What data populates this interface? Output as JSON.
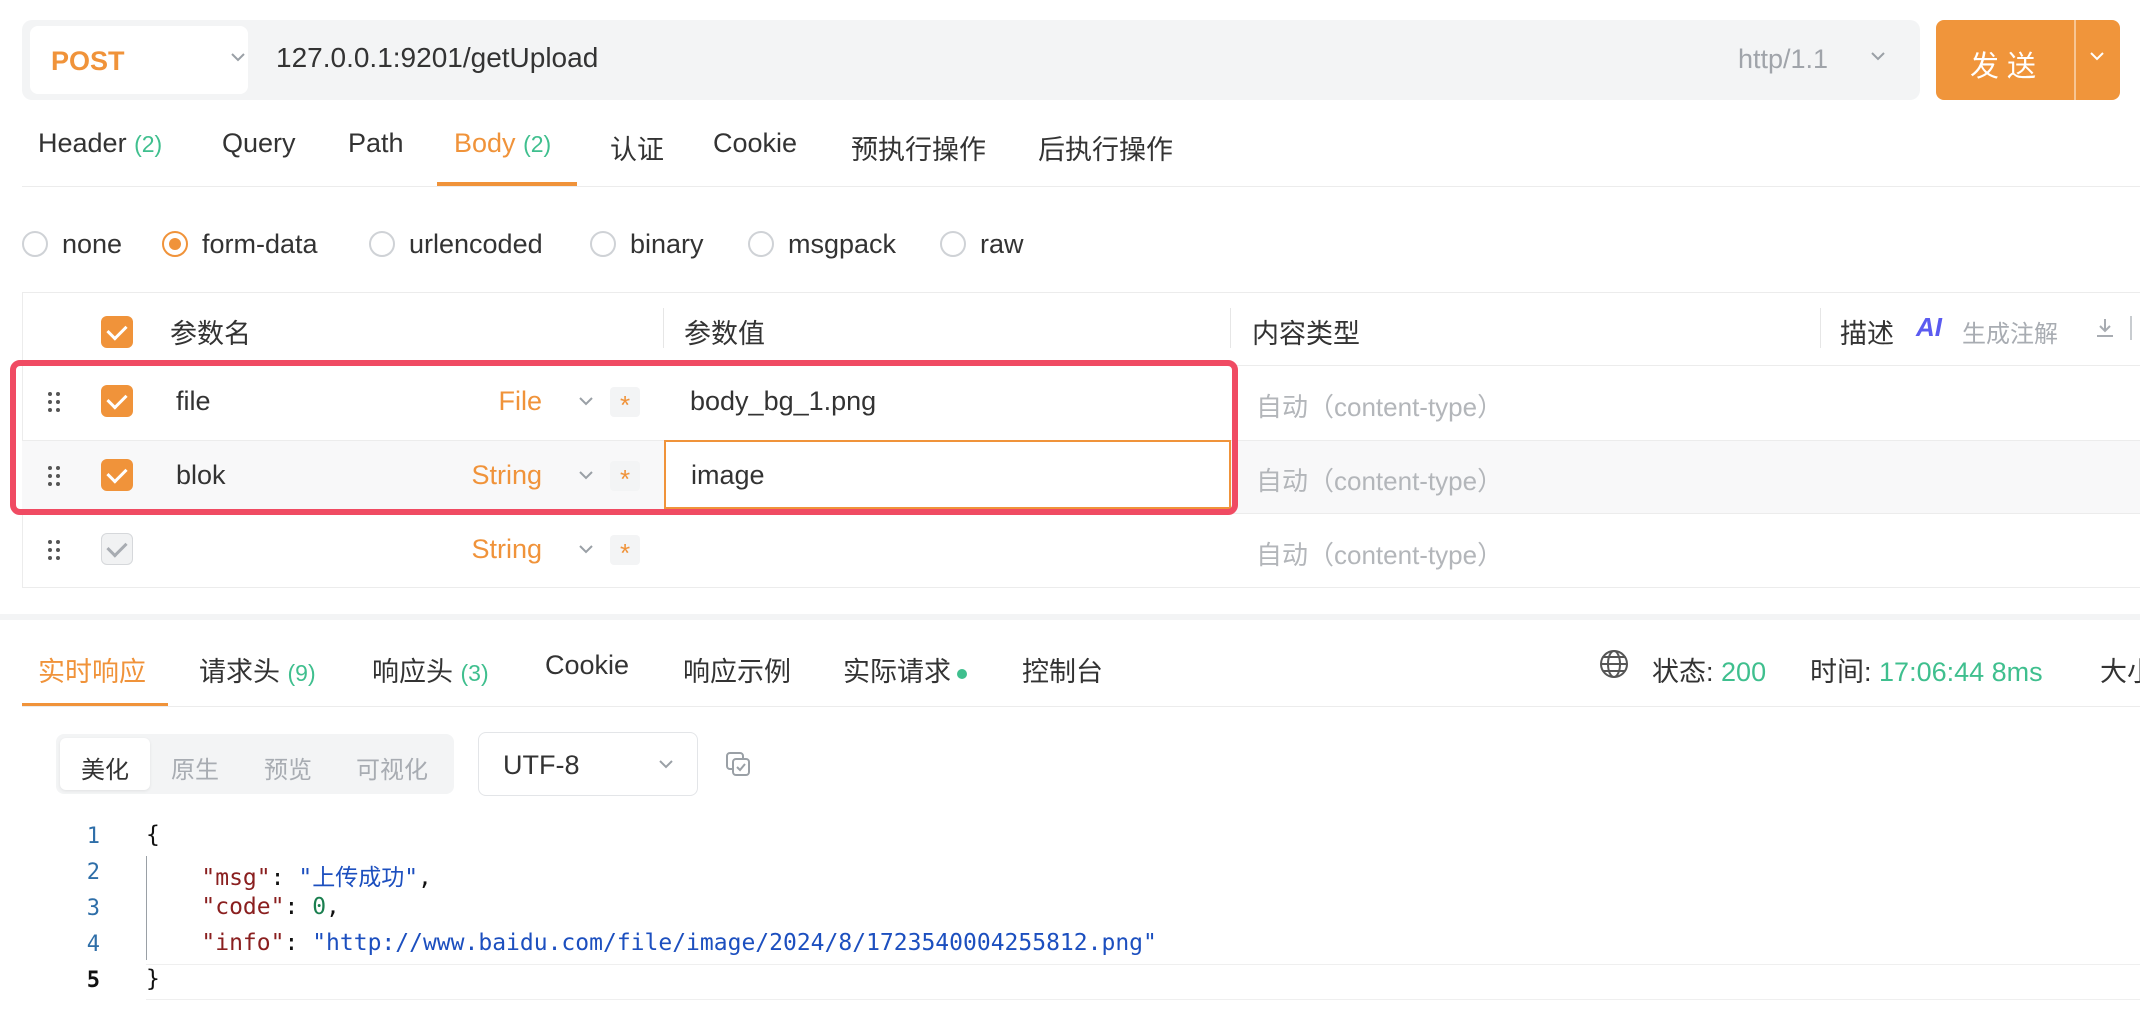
{
  "url_bar": {
    "method": "POST",
    "url": "127.0.0.1:9201/getUpload",
    "protocol": "http/1.1",
    "send_label": "发送"
  },
  "request_tabs": [
    {
      "label": "Header",
      "count": "(2)"
    },
    {
      "label": "Query",
      "count": ""
    },
    {
      "label": "Path",
      "count": ""
    },
    {
      "label": "Body",
      "count": "(2)",
      "active": true
    },
    {
      "label": "认证",
      "count": ""
    },
    {
      "label": "Cookie",
      "count": ""
    },
    {
      "label": "预执行操作",
      "count": ""
    },
    {
      "label": "后执行操作",
      "count": ""
    }
  ],
  "body_types": [
    {
      "label": "none",
      "selected": false
    },
    {
      "label": "form-data",
      "selected": true
    },
    {
      "label": "urlencoded",
      "selected": false
    },
    {
      "label": "binary",
      "selected": false
    },
    {
      "label": "msgpack",
      "selected": false
    },
    {
      "label": "raw",
      "selected": false
    }
  ],
  "params_table": {
    "headers": {
      "name": "参数名",
      "value": "参数值",
      "content_type": "内容类型",
      "description": "描述",
      "ai_badge": "AI",
      "generate": "生成注解"
    },
    "rows": [
      {
        "checked": true,
        "name": "file",
        "type": "File",
        "required": "*",
        "value": "body_bg_1.png",
        "content_type": "自动（content-type）"
      },
      {
        "checked": true,
        "name": "blok",
        "type": "String",
        "required": "*",
        "value": "image",
        "content_type": "自动（content-type）"
      },
      {
        "checked": false,
        "name": "",
        "type": "String",
        "required": "*",
        "value": "",
        "content_type": "自动（content-type）"
      }
    ]
  },
  "response_tabs": [
    {
      "label": "实时响应",
      "count": "",
      "active": true
    },
    {
      "label": "请求头",
      "count": "(9)"
    },
    {
      "label": "响应头",
      "count": "(3)"
    },
    {
      "label": "Cookie",
      "count": ""
    },
    {
      "label": "响应示例",
      "count": ""
    },
    {
      "label": "实际请求",
      "count": "",
      "dot": true
    },
    {
      "label": "控制台",
      "count": ""
    }
  ],
  "response_status": {
    "status_label": "状态:",
    "status_value": "200",
    "time_label": "时间:",
    "time_value": "17:06:44",
    "duration": "8ms",
    "size_label": "大小"
  },
  "view_modes": [
    "美化",
    "原生",
    "预览",
    "可视化"
  ],
  "view_mode_selected": "美化",
  "encoding": "UTF-8",
  "code": {
    "line_numbers": [
      "1",
      "2",
      "3",
      "4",
      "5"
    ],
    "open": "{",
    "close": "}",
    "entries": [
      {
        "key": "\"msg\"",
        "value": "\"上传成功\"",
        "comma": ","
      },
      {
        "key": "\"code\"",
        "value": "0",
        "comma": ","
      },
      {
        "key": "\"info\"",
        "value": "\"http://www.baidu.com/file/image/2024/8/1723540004255812.png\"",
        "comma": ""
      }
    ]
  },
  "colors": {
    "accent": "#f0933a",
    "highlight_border": "#f04b63",
    "count_green": "#3fbf8e"
  }
}
